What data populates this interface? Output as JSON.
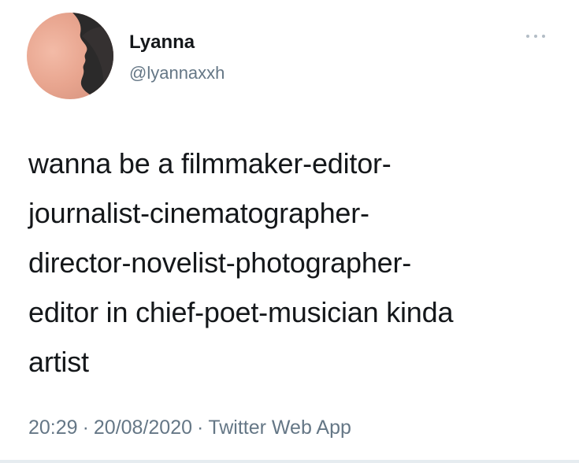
{
  "author": {
    "display_name": "Lyanna",
    "handle": "@lyannaxxh"
  },
  "tweet": {
    "text": "wanna be a filmmaker-editor-\njournalist-cinematographer-\ndirector-novelist-photographer-\neditor in chief-poet-musician  kinda\nartist",
    "time": "20:29",
    "separator": "·",
    "date": "20/08/2020",
    "source": "Twitter Web App"
  },
  "icons": {
    "more": "more-horizontal-icon"
  },
  "colors": {
    "text": "#14171a",
    "secondary": "#657786",
    "avatar_skin": "#e8a58f",
    "avatar_shadow": "#2b2a2a"
  }
}
